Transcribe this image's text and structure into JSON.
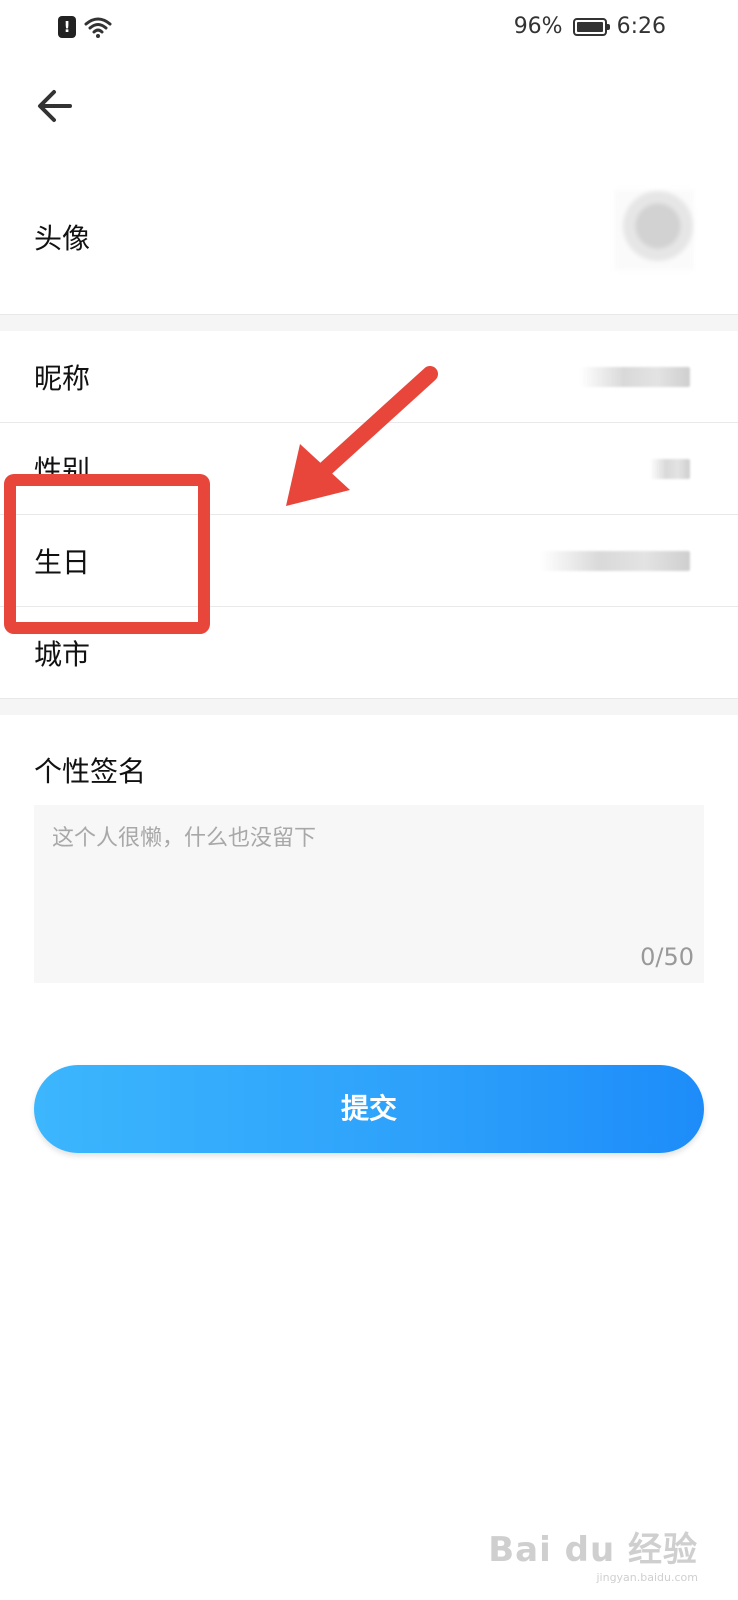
{
  "status_bar": {
    "battery": "96%",
    "time": "6:26"
  },
  "profile": {
    "avatar_label": "头像",
    "nickname_label": "昵称",
    "gender_label": "性别",
    "birthday_label": "生日",
    "city_label": "城市"
  },
  "signature": {
    "label": "个性签名",
    "placeholder": "这个人很懒，什么也没留下",
    "count": "0/50"
  },
  "submit": {
    "label": "提交"
  },
  "colors": {
    "accent_start": "#3cb6fd",
    "accent_end": "#1d8cf9",
    "annotation": "#e8453b"
  },
  "watermark": {
    "main": "Bai du 经验",
    "sub": "jingyan.baidu.com"
  }
}
